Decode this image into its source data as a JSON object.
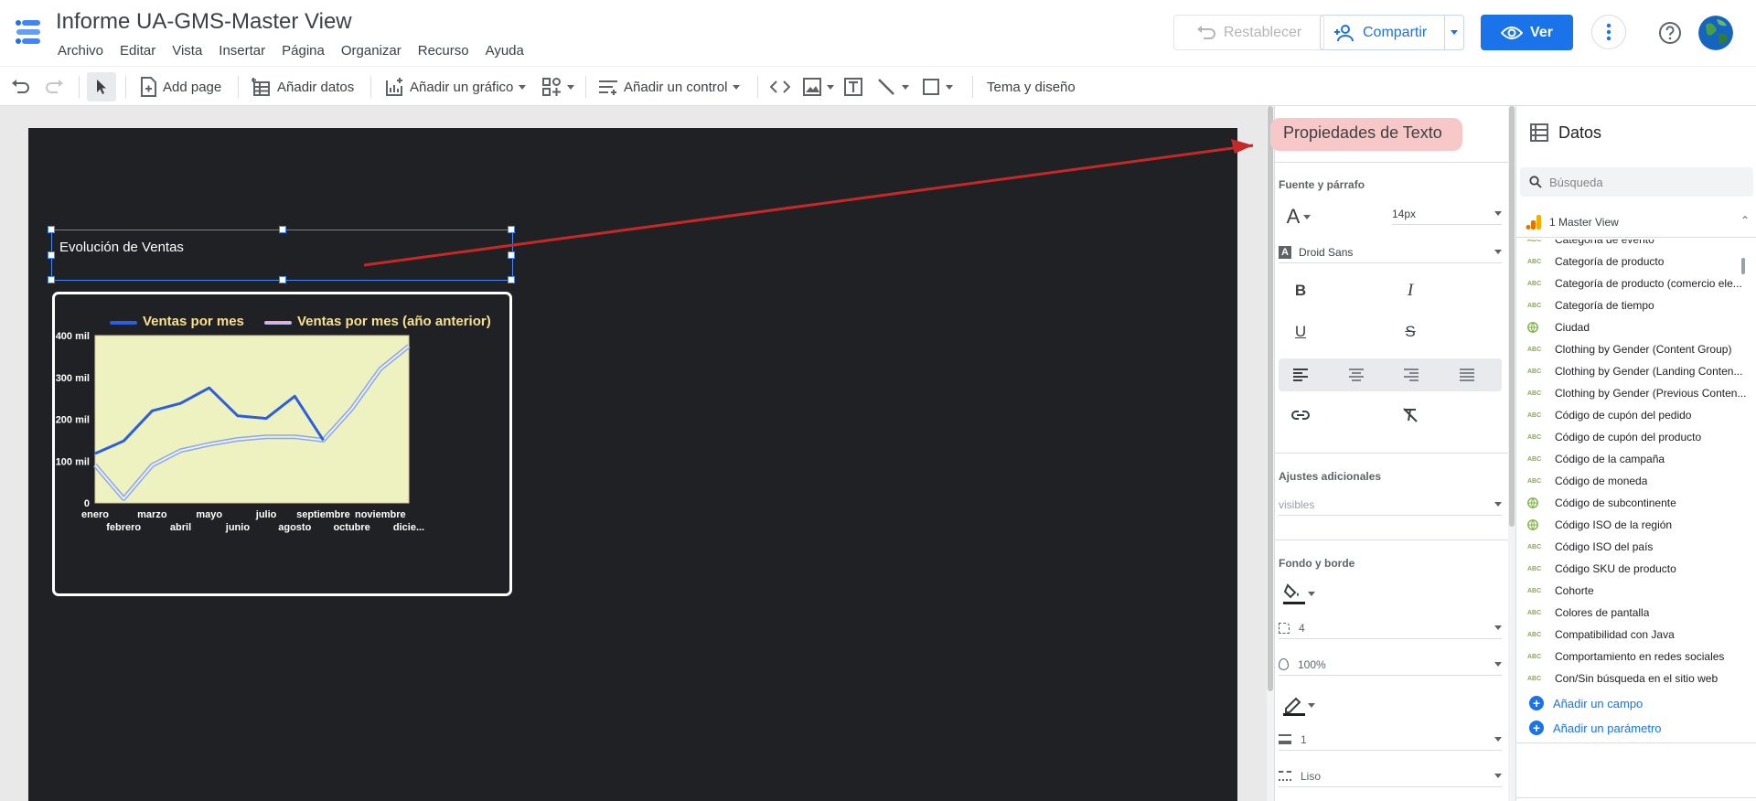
{
  "header": {
    "title": "Informe UA-GMS-Master View",
    "menu": [
      "Archivo",
      "Editar",
      "Vista",
      "Insertar",
      "Página",
      "Organizar",
      "Recurso",
      "Ayuda"
    ],
    "reset_label": "Restablecer",
    "share_label": "Compartir",
    "view_label": "Ver"
  },
  "toolbar": {
    "add_page": "Add page",
    "add_data": "Añadir datos",
    "add_chart": "Añadir un gráfico",
    "add_control": "Añadir un control",
    "theme": "Tema y diseño"
  },
  "canvas": {
    "textbox_text": "Evolución de Ventas",
    "chart_data": {
      "type": "line",
      "categories": [
        "enero",
        "febrero",
        "marzo",
        "abril",
        "mayo",
        "junio",
        "julio",
        "agosto",
        "septiembre",
        "octubre",
        "noviembre",
        "dicie..."
      ],
      "series": [
        {
          "name": "Ventas por mes",
          "color": "#2b5fe0",
          "values": [
            118000,
            148000,
            220000,
            238000,
            275000,
            208000,
            202000,
            255000,
            150000,
            null,
            null,
            null
          ]
        },
        {
          "name": "Ventas por mes (año anterior)",
          "color": "#a8c0f0",
          "values": [
            90000,
            10000,
            90000,
            125000,
            140000,
            152000,
            158000,
            158000,
            150000,
            225000,
            320000,
            375000
          ]
        }
      ],
      "y_ticks": [
        "400 mil",
        "300 mil",
        "200 mil",
        "100 mil",
        "0"
      ],
      "ylim": [
        0,
        400000
      ],
      "plot_background": "#eef2c1",
      "legend_position": "top"
    }
  },
  "props": {
    "title": "Propiedades de Texto",
    "section_font": "Fuente y párrafo",
    "font_size": "14px",
    "font_family": "Droid Sans",
    "section_extra": "Ajustes adicionales",
    "visibility": "visibles",
    "section_bg": "Fondo y borde",
    "radius": "4",
    "opacity": "100%",
    "border_width": "1",
    "border_style": "Liso"
  },
  "data": {
    "title": "Datos",
    "search_placeholder": "Búsqueda",
    "source": "1 Master View",
    "fields": [
      {
        "type": "ABC",
        "name": "Categoría de evento"
      },
      {
        "type": "ABC",
        "name": "Categoría de producto"
      },
      {
        "type": "ABC",
        "name": "Categoría de producto (comercio ele..."
      },
      {
        "type": "ABC",
        "name": "Categoría de tiempo"
      },
      {
        "type": "geo",
        "name": "Ciudad"
      },
      {
        "type": "ABC",
        "name": "Clothing by Gender (Content Group)"
      },
      {
        "type": "ABC",
        "name": "Clothing by Gender (Landing Conten..."
      },
      {
        "type": "ABC",
        "name": "Clothing by Gender (Previous Conten..."
      },
      {
        "type": "ABC",
        "name": "Código de cupón del pedido"
      },
      {
        "type": "ABC",
        "name": "Código de cupón del producto"
      },
      {
        "type": "ABC",
        "name": "Código de la campaña"
      },
      {
        "type": "ABC",
        "name": "Código de moneda"
      },
      {
        "type": "geo",
        "name": "Código de subcontinente"
      },
      {
        "type": "geo",
        "name": "Código ISO de la región"
      },
      {
        "type": "ABC",
        "name": "Código ISO del país"
      },
      {
        "type": "ABC",
        "name": "Código SKU de producto"
      },
      {
        "type": "ABC",
        "name": "Cohorte"
      },
      {
        "type": "ABC",
        "name": "Colores de pantalla"
      },
      {
        "type": "ABC",
        "name": "Compatibilidad con Java"
      },
      {
        "type": "ABC",
        "name": "Comportamiento en redes sociales"
      },
      {
        "type": "ABC",
        "name": "Con/Sin búsqueda en el sitio web"
      }
    ],
    "add_field": "Añadir un campo",
    "add_param": "Añadir un parámetro"
  }
}
